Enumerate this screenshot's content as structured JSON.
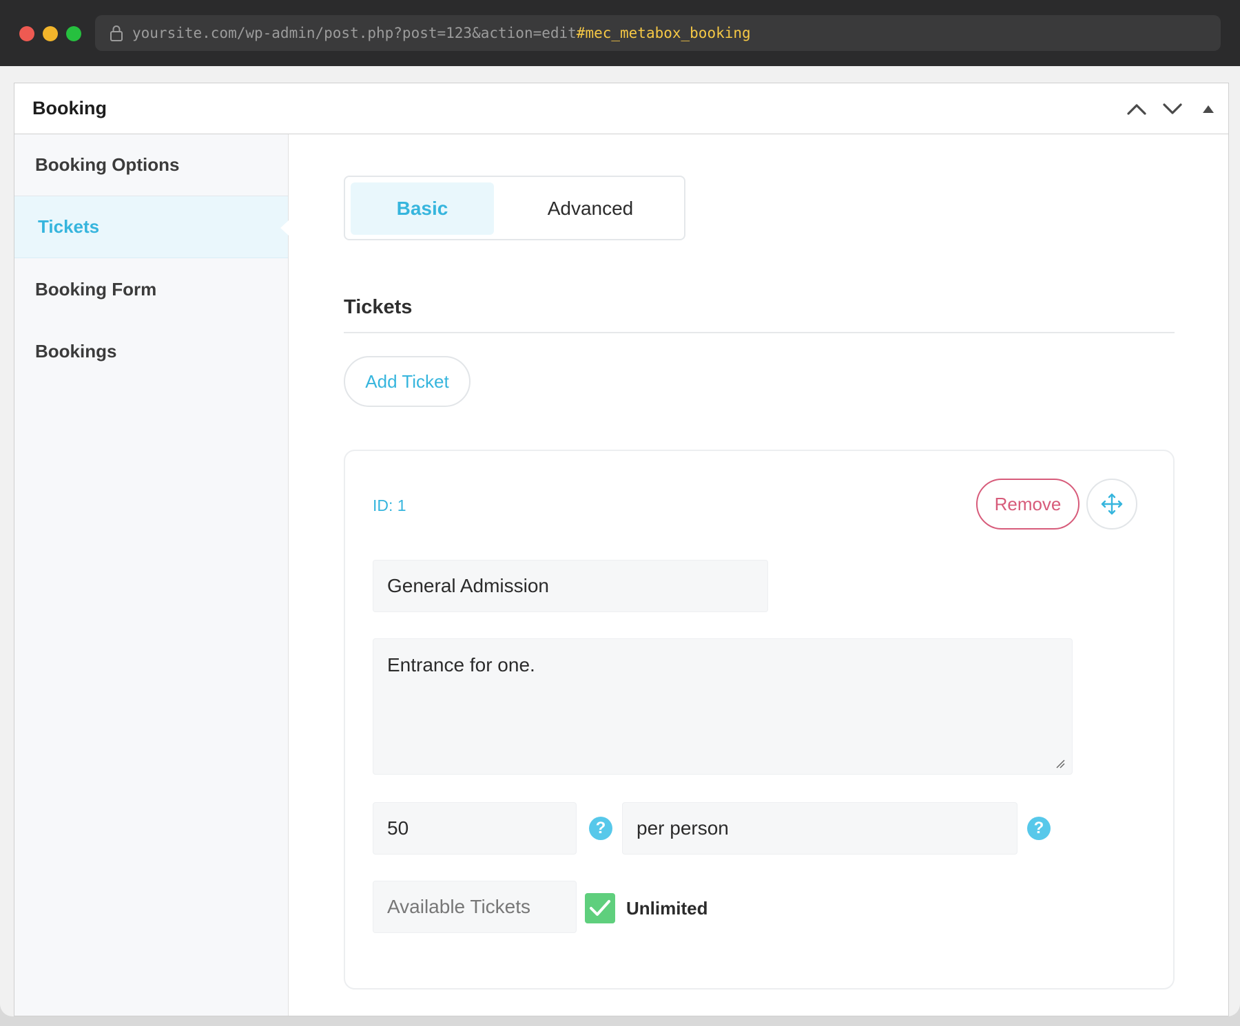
{
  "browser": {
    "url_base": "yoursite.com/wp-admin/post.php?post=123&action=edit",
    "url_hash": "#mec_metabox_booking"
  },
  "metabox": {
    "title": "Booking"
  },
  "sidebar": {
    "items": [
      {
        "label": "Booking Options"
      },
      {
        "label": "Tickets"
      },
      {
        "label": "Booking Form"
      },
      {
        "label": "Bookings"
      }
    ]
  },
  "tabs": {
    "basic": "Basic",
    "advanced": "Advanced"
  },
  "section": {
    "title": "Tickets",
    "add_button": "Add Ticket"
  },
  "ticket": {
    "id_label": "ID: 1",
    "remove_label": "Remove",
    "name": "General Admission",
    "description": "Entrance for one.",
    "price": "50",
    "price_label": "per person",
    "available_placeholder": "Available Tickets",
    "unlimited_label": "Unlimited",
    "unlimited_checked": true,
    "help_glyph": "?"
  },
  "colors": {
    "accent": "#36b5dd",
    "remove": "#d75b7a",
    "checkbox": "#5fcf7d",
    "url_hash": "#f6c845"
  },
  "icons": [
    "lock-icon",
    "chevron-up-icon",
    "chevron-down-icon",
    "caret-up-icon",
    "move-icon",
    "help-icon",
    "checkmark-icon",
    "resize-handle-icon"
  ]
}
